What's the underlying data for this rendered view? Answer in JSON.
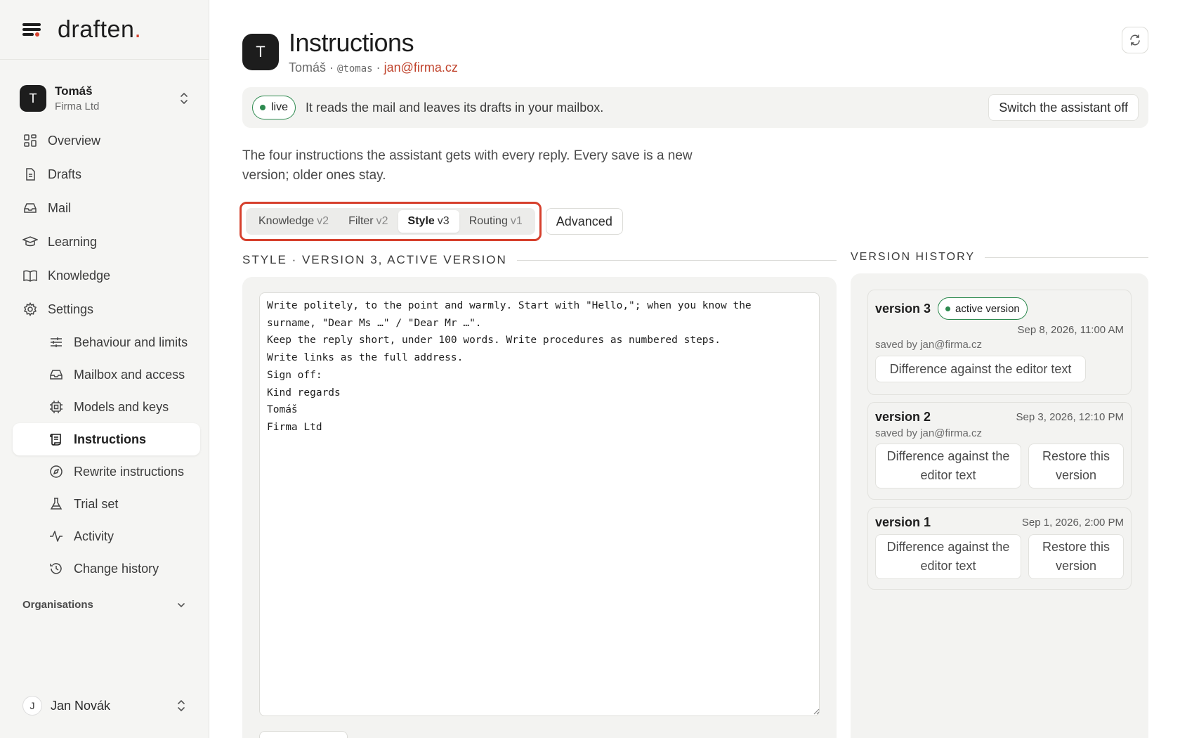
{
  "brand": {
    "name": "draften",
    "dot": "."
  },
  "account": {
    "initial": "T",
    "name": "Tomáš",
    "org": "Firma Ltd"
  },
  "nav": {
    "overview": "Overview",
    "drafts": "Drafts",
    "mail": "Mail",
    "learning": "Learning",
    "knowledge": "Knowledge",
    "settings": "Settings",
    "sub": {
      "behaviour": "Behaviour and limits",
      "mailbox": "Mailbox and access",
      "models": "Models and keys",
      "instructions": "Instructions",
      "rewrite": "Rewrite instructions",
      "trial": "Trial set",
      "activity": "Activity",
      "history": "Change history"
    }
  },
  "organisations_label": "Organisations",
  "user": {
    "initial": "J",
    "name": "Jan Novák"
  },
  "header": {
    "initial": "T",
    "title": "Instructions",
    "name": "Tomáš",
    "sep1": " · ",
    "handle": "@tomas",
    "sep2": " · ",
    "email": "jan@firma.cz"
  },
  "status": {
    "badge": "live",
    "text": "It reads the mail and leaves its drafts in your mailbox.",
    "switch_label": "Switch the assistant off"
  },
  "description": "The four instructions the assistant gets with every reply. Every save is a new version; older ones stay.",
  "tabs": [
    {
      "label": "Knowledge",
      "version": "v2",
      "active": false
    },
    {
      "label": "Filter",
      "version": "v2",
      "active": false
    },
    {
      "label": "Style",
      "version": "v3",
      "active": true
    },
    {
      "label": "Routing",
      "version": "v1",
      "active": false
    }
  ],
  "advanced_label": "Advanced",
  "editor_section_label": "STYLE · VERSION 3, ACTIVE VERSION",
  "editor_text": "Write politely, to the point and warmly. Start with \"Hello,\"; when you know the\nsurname, \"Dear Ms …\" / \"Dear Mr …\".\nKeep the reply short, under 100 words. Write procedures as numbered steps.\nWrite links as the full address.\nSign off:\nKind regards\nTomáš\nFirma Ltd",
  "history_label": "VERSION HISTORY",
  "versions": [
    {
      "name": "version 3",
      "active_badge": "active version",
      "date": "Sep 8, 2026, 11:00 AM",
      "saved_by": "saved by jan@firma.cz",
      "diff_label": "Difference against the editor text"
    },
    {
      "name": "version 2",
      "date": "Sep 3, 2026, 12:10 PM",
      "saved_by": "saved by jan@firma.cz",
      "diff_label": "Difference against the editor text",
      "restore_label": "Restore this version"
    },
    {
      "name": "version 1",
      "date": "Sep 1, 2026, 2:00 PM",
      "diff_label": "Difference against the editor text",
      "restore_label": "Restore this version"
    }
  ],
  "colors": {
    "accent": "#d6402d",
    "live": "#2d8a4f",
    "email": "#c0432c"
  }
}
